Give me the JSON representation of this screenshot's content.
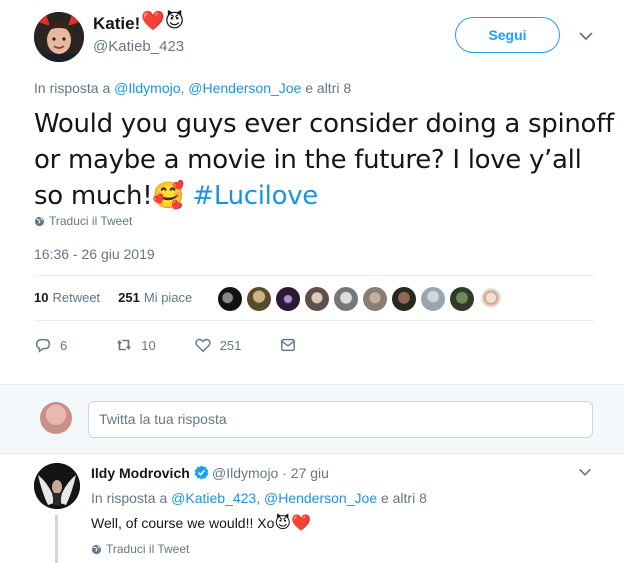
{
  "tweet": {
    "display_name": "Katie!",
    "name_emoji": "❤️😈",
    "handle": "@Katieb_423",
    "follow_label": "Segui",
    "reply_prefix": "In risposta a",
    "reply_users": [
      "@Ildymojo",
      "@Henderson_Joe"
    ],
    "reply_sep": ", ",
    "reply_suffix": "e altri 8",
    "text_main": "Would you guys ever consider doing a spinoff or maybe a movie in the future? I love y’all so much!",
    "text_emoji": "🥰",
    "hashtag": "#Lucilove",
    "translate_label": "Traduci il Tweet",
    "timestamp": "16:36 - 26 giu 2019",
    "retweets_count": "10",
    "retweets_label": "Retweet",
    "likes_count": "251",
    "likes_label": "Mi piace",
    "actions": {
      "reply_count": "6",
      "retweet_count": "10",
      "like_count": "251"
    }
  },
  "composer": {
    "placeholder": "Twitta la tua risposta"
  },
  "reply": {
    "display_name": "Ildy Modrovich",
    "handle": "@Ildymojo",
    "dot": "·",
    "date": "27 giu",
    "reply_prefix": "In risposta a",
    "reply_users": [
      "@Katieb_423",
      "@Henderson_Joe"
    ],
    "reply_sep": ", ",
    "reply_suffix": "e altri 8",
    "text": "Well, of course we would!! Xo",
    "text_emoji": "😈❤️",
    "translate_label": "Traduci il Tweet"
  },
  "colors": {
    "accent": "#1da1f2",
    "link": "#1b95e0",
    "muted": "#657786",
    "heart": "#e0245e"
  }
}
